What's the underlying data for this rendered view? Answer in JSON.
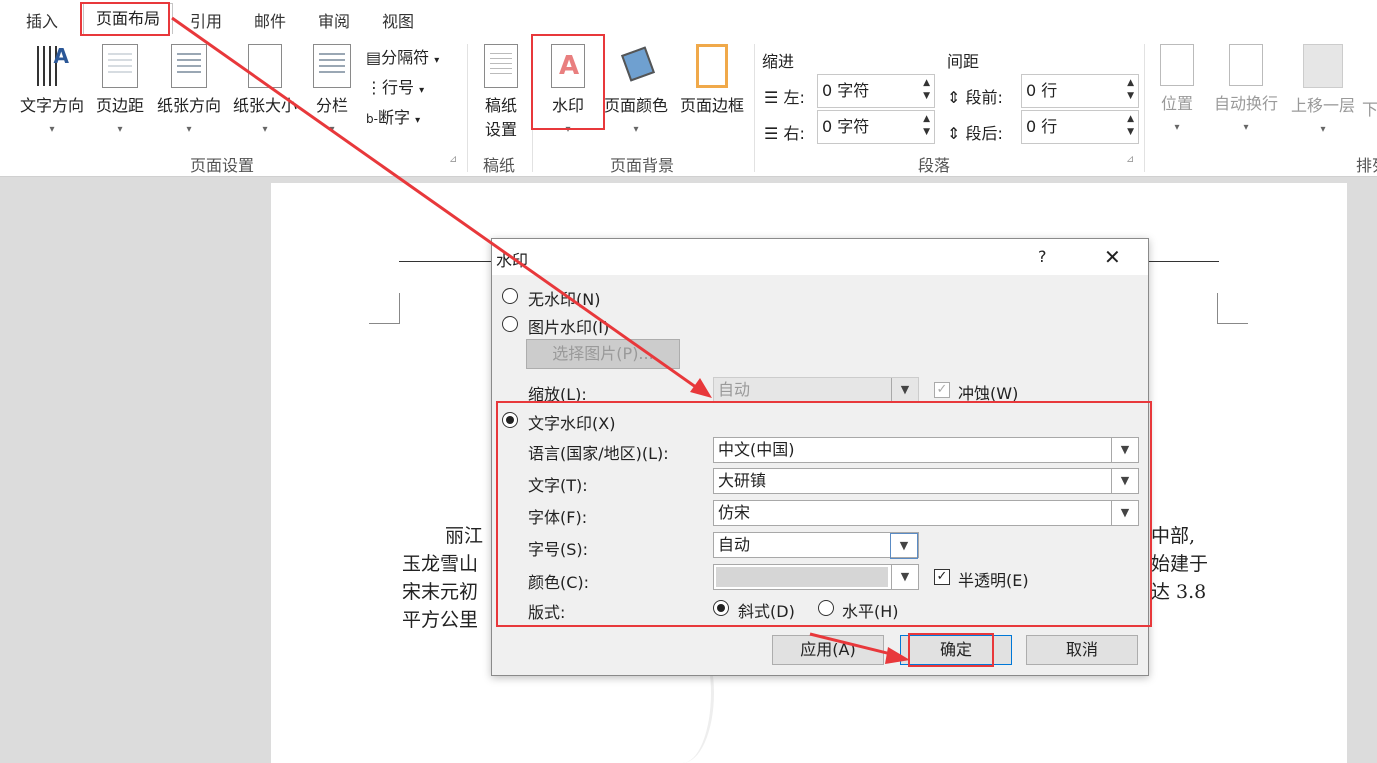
{
  "tabs": {
    "insert": "插入",
    "layout": "页面布局",
    "references": "引用",
    "mailings": "邮件",
    "review": "审阅",
    "view": "视图"
  },
  "ribbon": {
    "text_direction": "文字方向",
    "margins": "页边距",
    "orientation": "纸张方向",
    "size": "纸张大小",
    "columns": "分栏",
    "breaks": "分隔符",
    "line_numbers": "行号",
    "hyphenation": "断字",
    "draft_l1": "稿纸",
    "draft_l2": "设置",
    "watermark": "水印",
    "page_color": "页面颜色",
    "page_borders": "页面边框",
    "indent_title": "缩进",
    "indent_left": "左:",
    "indent_left_val": "0 字符",
    "indent_right": "右:",
    "indent_right_val": "0 字符",
    "spacing_title": "间距",
    "spacing_before": "段前:",
    "spacing_before_val": "0 行",
    "spacing_after": "段后:",
    "spacing_after_val": "0 行",
    "position": "位置",
    "wrap_text": "自动换行",
    "bring_forward": "上移一层",
    "send_back_fragment": "下",
    "group_page_setup": "页面设置",
    "group_draft": "稿纸",
    "group_page_bg": "页面背景",
    "group_paragraph": "段落",
    "group_arrange_fragment": "排列"
  },
  "document": {
    "line1_left": "丽江",
    "line1_right": "中部,",
    "line2_left": "玉龙雪山",
    "line2_right": "始建于",
    "line3_left": "宋末元初",
    "line3_right": "达 3.8",
    "line4_left": "平方公里"
  },
  "dialog": {
    "title": "水印",
    "help": "?",
    "close": "✕",
    "no_watermark": "无水印(N)",
    "picture_watermark": "图片水印(I)",
    "select_picture": "选择图片(P)...",
    "scale_label": "缩放(L):",
    "scale_value": "自动",
    "washout": "冲蚀(W)",
    "text_watermark": "文字水印(X)",
    "language_label": "语言(国家/地区)(L):",
    "language_value": "中文(中国)",
    "text_label": "文字(T):",
    "text_value": "大研镇",
    "font_label": "字体(F):",
    "font_value": "仿宋",
    "size_label": "字号(S):",
    "size_value": "自动",
    "color_label": "颜色(C):",
    "semitransparent": "半透明(E)",
    "layout_label": "版式:",
    "diagonal": "斜式(D)",
    "horizontal": "水平(H)",
    "apply": "应用(A)",
    "ok": "确定",
    "cancel": "取消"
  },
  "colors": {
    "accent_red": "#e8383b",
    "watermark_icon_red": "#e04a4a"
  }
}
